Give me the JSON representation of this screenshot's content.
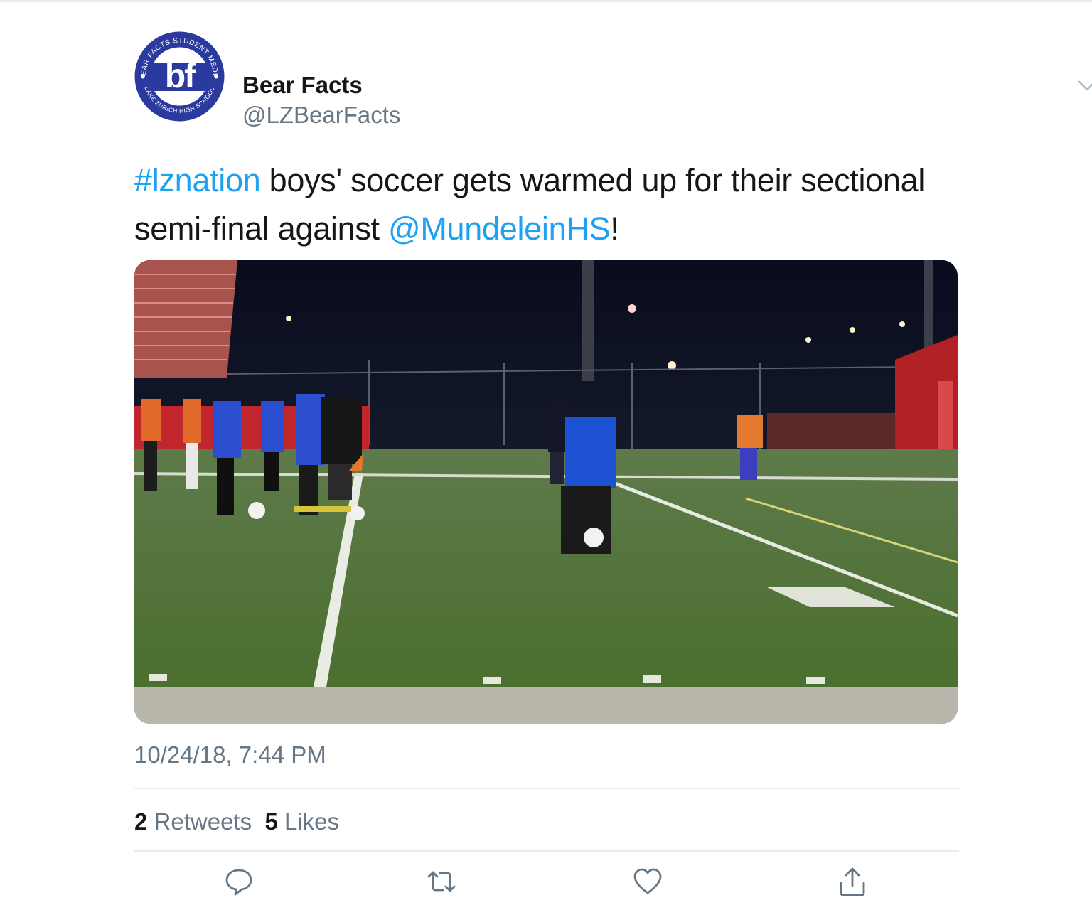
{
  "account": {
    "display_name": "Bear Facts",
    "handle": "@LZBearFacts",
    "avatar_logo": {
      "letters": "bf",
      "ring_text_top": "BEAR FACTS STUDENT MEDIA",
      "ring_text_bottom": "LAKE ZURICH HIGH SCHOOL",
      "color": "#2b3a9e"
    }
  },
  "tweet": {
    "hashtag": "#lznation",
    "text_part1": " boys' soccer gets warmed up for their sectional semi-final against ",
    "mention": "@MundeleinHS",
    "text_part2": "!",
    "timestamp": "10/24/18, 7:44 PM"
  },
  "stats": {
    "retweets_count": "2",
    "retweets_label": "Retweets",
    "likes_count": "5",
    "likes_label": "Likes"
  },
  "icons": {
    "caret": "chevron-down-icon",
    "reply": "reply-icon",
    "retweet": "retweet-icon",
    "like": "heart-icon",
    "share": "share-icon"
  },
  "colors": {
    "link": "#1da1f2",
    "secondary_text": "#657786",
    "icon": "#657786",
    "divider": "#e6ecf0"
  }
}
